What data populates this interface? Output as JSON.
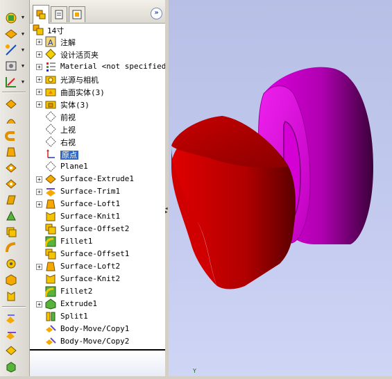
{
  "feature_tree": {
    "root": "14寸",
    "items": [
      {
        "label": "注解",
        "expandable": true
      },
      {
        "label": "设计活页夹",
        "expandable": true
      },
      {
        "label": "Material <not specified>",
        "expandable": true
      },
      {
        "label": "光源与相机",
        "expandable": true
      },
      {
        "label": "曲面实体(3)",
        "expandable": true
      },
      {
        "label": "实体(3)",
        "expandable": true
      },
      {
        "label": "前视",
        "expandable": false
      },
      {
        "label": "上视",
        "expandable": false
      },
      {
        "label": "右视",
        "expandable": false
      },
      {
        "label": "原点",
        "expandable": false,
        "selected": true
      },
      {
        "label": "Plane1",
        "expandable": false
      },
      {
        "label": "Surface-Extrude1",
        "expandable": true
      },
      {
        "label": "Surface-Trim1",
        "expandable": true
      },
      {
        "label": "Surface-Loft1",
        "expandable": true
      },
      {
        "label": "Surface-Knit1",
        "expandable": false
      },
      {
        "label": "Surface-Offset2",
        "expandable": false
      },
      {
        "label": "Fillet1",
        "expandable": false
      },
      {
        "label": "Surface-Offset1",
        "expandable": false
      },
      {
        "label": "Surface-Loft2",
        "expandable": true
      },
      {
        "label": "Surface-Knit2",
        "expandable": false
      },
      {
        "label": "Fillet2",
        "expandable": false
      },
      {
        "label": "Extrude1",
        "expandable": true
      },
      {
        "label": "Split1",
        "expandable": false
      },
      {
        "label": "Body-Move/Copy1",
        "expandable": false
      },
      {
        "label": "Body-Move/Copy2",
        "expandable": false
      }
    ]
  },
  "panel": {
    "collapse_glyph": "»"
  },
  "viewport": {
    "axis_label": "Y",
    "bodies": [
      {
        "name": "red-body",
        "color": "#c40000"
      },
      {
        "name": "magenta-body",
        "color": "#cc00cc"
      }
    ]
  },
  "colors": {
    "selection": "#316ac5",
    "viewport_bg": "#c4cbef"
  }
}
